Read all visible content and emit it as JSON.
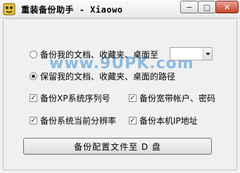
{
  "window": {
    "title": "重装备份助手 - Xiaowo",
    "min_glyph": "−",
    "max_glyph": "□",
    "close_glyph": "✕"
  },
  "options": {
    "backup_docs": {
      "label": "备份我的文档、收藏夹、桌面至",
      "selected": false
    },
    "keep_paths": {
      "label": "保留我的文档、收藏夹、桌面的路径",
      "selected": true
    },
    "backup_serial": {
      "label": "备份XP系统序列号",
      "checked": true
    },
    "backup_accounts": {
      "label": "备份宽带帐户、密码",
      "checked": true
    },
    "backup_resolution": {
      "label": "备份系统当前分辨率",
      "checked": true
    },
    "backup_ip": {
      "label": "备份本机IP地址",
      "checked": true
    }
  },
  "target_drive": {
    "value": ""
  },
  "action": {
    "label": "备份配置文件至 D 盘"
  },
  "watermark": {
    "text": "www.9UPK.com"
  },
  "colors": {
    "watermark": "#3c8fd8",
    "close_button": "#c8412b"
  }
}
